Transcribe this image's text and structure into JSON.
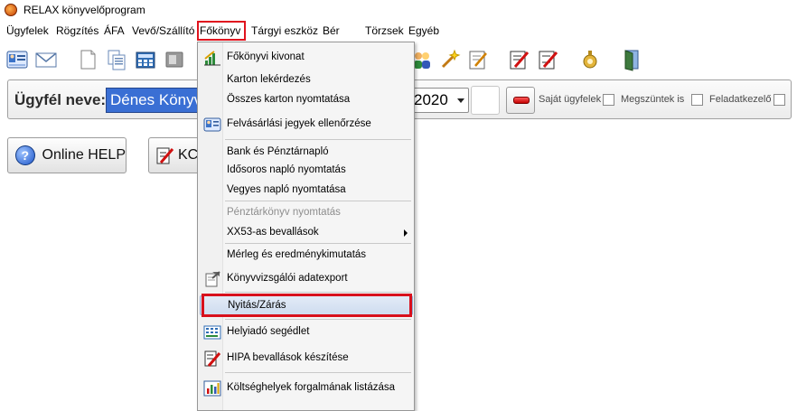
{
  "window": {
    "title": "RELAX könyvelőprogram"
  },
  "menubar": {
    "items": [
      {
        "label": "Ügyfelek"
      },
      {
        "label": "Rögzítés"
      },
      {
        "label": "ÁFA"
      },
      {
        "label": "Vevő/Szállító"
      },
      {
        "label": "Főkönyv"
      },
      {
        "label": "Tárgyi eszköz"
      },
      {
        "label": "Bér"
      },
      {
        "label": "Törzsek"
      },
      {
        "label": "Egyéb"
      }
    ],
    "open_menu": "Főkönyv"
  },
  "clientbar": {
    "client_label": "Ügyfél neve:",
    "client_value": "Dénes Könyv",
    "year_value": "2020",
    "checkboxes": [
      {
        "label": "Saját ügyfelek",
        "checked": false
      },
      {
        "label": "Megszüntek is",
        "checked": false
      },
      {
        "label": "Feladatkezelő",
        "checked": false
      }
    ]
  },
  "main_buttons": {
    "help_label": "Online HELP",
    "second_label": "KC"
  },
  "dropdown": {
    "items": [
      {
        "label": "Főkönyvi kivonat",
        "icon": "ledger-chart-icon"
      },
      {
        "label": "Karton lekérdezés"
      },
      {
        "label": "Összes karton nyomtatása"
      },
      {
        "label": "Felvásárlási jegyek ellenőrzése",
        "icon": "id-card-icon"
      },
      {
        "label": "Bank és Pénztárnapló"
      },
      {
        "label": "Idősoros napló nyomtatás"
      },
      {
        "label": "Vegyes napló nyomtatása"
      },
      {
        "label": "Pénztárkönyv nyomtatás",
        "disabled": true
      },
      {
        "label": "XX53-as bevallások",
        "submenu": true
      },
      {
        "label": "Mérleg és eredménykimutatás"
      },
      {
        "label": "Könyvvizsgálói adatexport",
        "icon": "export-document-icon"
      },
      {
        "label": "Nyitás/Zárás",
        "highlighted": true
      },
      {
        "label": "Helyiadó segédlet",
        "icon": "calculator-sheet-icon"
      },
      {
        "label": "HIPA bevallások készítése",
        "icon": "form-pen-icon"
      },
      {
        "label": "Költséghelyek forgalmának listázása",
        "icon": "bar-chart-icon"
      }
    ]
  },
  "colors": {
    "highlight_frame": "#d8101c",
    "selection_blue": "#3a6fd4",
    "menu_highlight": "#cfdcef"
  }
}
